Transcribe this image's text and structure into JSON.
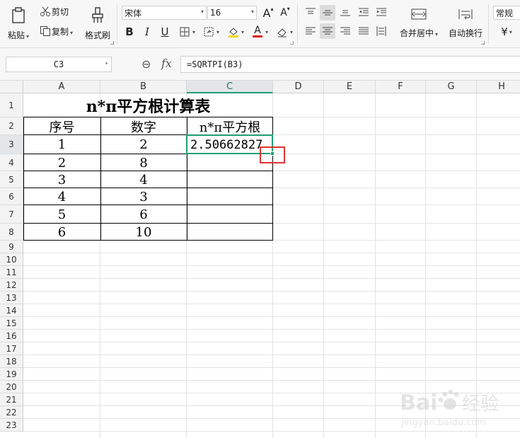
{
  "ribbon": {
    "paste_label": "粘贴",
    "cut_label": "剪切",
    "copy_label": "复制",
    "format_painter_label": "格式刷",
    "font_name": "宋体",
    "font_size": "16",
    "grow_font_glyph": "A",
    "shrink_font_glyph": "A",
    "bold_glyph": "B",
    "italic_glyph": "I",
    "underline_glyph": "U",
    "font_color_glyph": "A",
    "merge_center_label": "合并居中",
    "wrap_text_label": "自动换行",
    "number_format": "常规",
    "currency_glyph": "¥",
    "icons": [
      "paste-icon",
      "cut-icon",
      "copy-icon",
      "format-painter-icon",
      "border-icon",
      "fill-style-icon",
      "fill-color-icon",
      "font-color-icon",
      "eraser-icon",
      "align-top-icon",
      "align-middle-icon",
      "align-bottom-icon",
      "decrease-indent-icon",
      "increase-indent-icon",
      "align-left-icon",
      "align-center-icon",
      "align-right-icon",
      "justify-icon",
      "distributed-icon",
      "merge-center-icon",
      "wrap-text-icon"
    ],
    "colors": {
      "fill_swatch": "#f5d800",
      "font_swatch": "#e02020"
    }
  },
  "formula_bar": {
    "cell_ref": "C3",
    "zoom_glyph": "⊖",
    "fx_label": "fx",
    "formula": "=SQRTPI(B3)"
  },
  "sheet": {
    "columns": [
      "A",
      "B",
      "C",
      "D",
      "E",
      "F",
      "G",
      "H"
    ],
    "rows": [
      "1",
      "2",
      "3",
      "4",
      "5",
      "6",
      "7",
      "8",
      "9",
      "10",
      "11",
      "12",
      "13",
      "14",
      "15",
      "16",
      "17",
      "18",
      "19",
      "20",
      "21",
      "22",
      "23"
    ],
    "selected_cell": "C3",
    "title": "n*π平方根计算表",
    "headers": [
      "序号",
      "数字",
      "n*π平方根"
    ],
    "data": [
      [
        "1",
        "2",
        "2.50662827"
      ],
      [
        "2",
        "8",
        ""
      ],
      [
        "3",
        "4",
        ""
      ],
      [
        "4",
        "3",
        ""
      ],
      [
        "5",
        "6",
        ""
      ],
      [
        "6",
        "10",
        ""
      ]
    ],
    "colors": {
      "selection": "#1e9e73",
      "annotation": "#e0342f"
    }
  },
  "watermark": {
    "brand": "Bai",
    "brand2": "经验",
    "url": "jingyan.baidu.com"
  }
}
